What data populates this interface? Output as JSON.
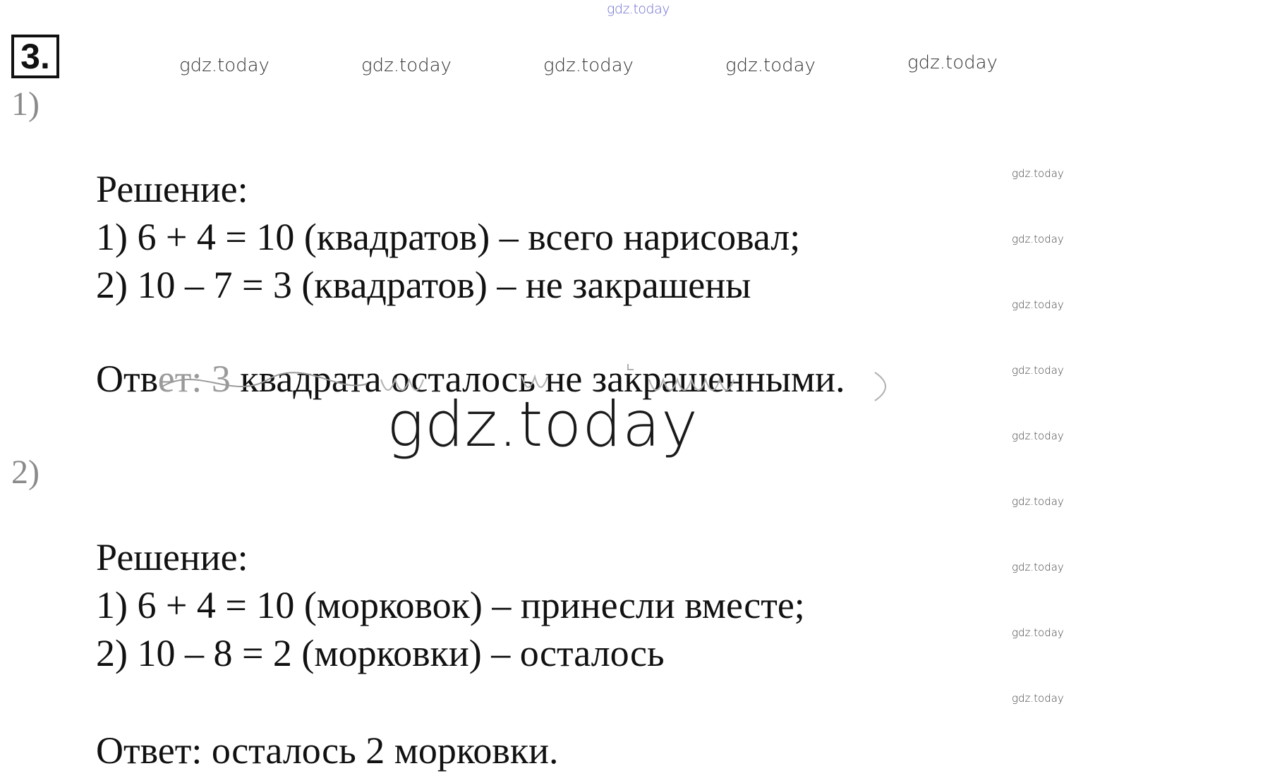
{
  "task": {
    "number": "3."
  },
  "watermarks": {
    "top": "gdz.today",
    "row": [
      "gdz.today",
      "gdz.today",
      "gdz.today",
      "gdz.today",
      "gdz.today"
    ],
    "side": [
      "gdz.today",
      "gdz.today",
      "gdz.today",
      "gdz.today",
      "gdz.today",
      "gdz.today",
      "gdz.today",
      "gdz.today",
      "gdz.today"
    ],
    "big": "gdz.today"
  },
  "parts": [
    {
      "label": "1)",
      "heading": "Решение:",
      "steps": [
        "1)  6 + 4 = 10 (квадратов) – всего нарисовал;",
        "2)  10 – 7 = 3 (квадратов) – не закрашены"
      ],
      "answer_start": "Отв",
      "answer_faded": "ет: 3",
      "answer_rest": " квадрата осталось не закрашенными."
    },
    {
      "label": "2)",
      "heading": "Решение:",
      "steps": [
        "1)  6 + 4 = 10 (морковок) – принесли вместе;",
        "2)  10 – 8 = 2 (морковки) – осталось"
      ],
      "answer": "Ответ: осталось 2 морковки."
    }
  ]
}
